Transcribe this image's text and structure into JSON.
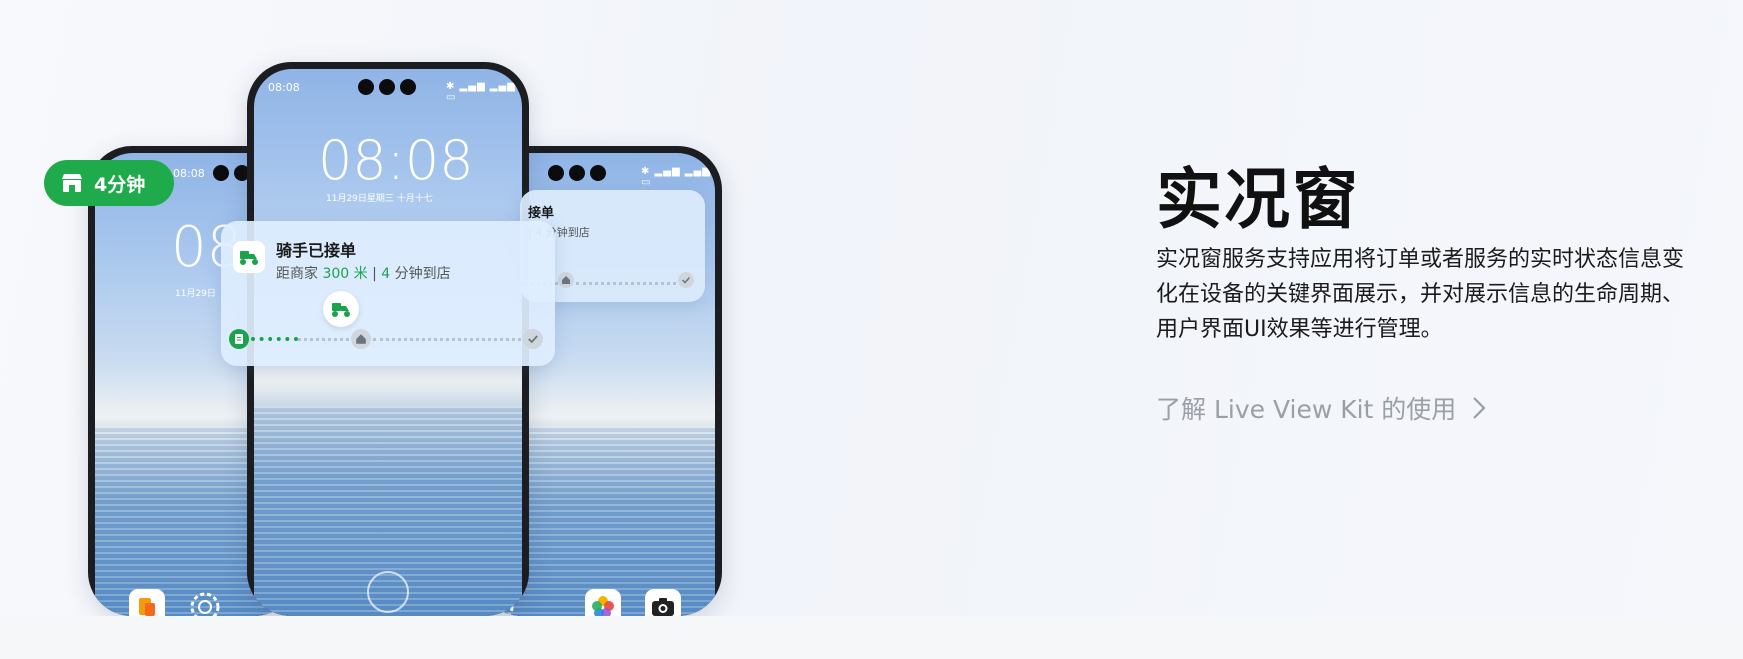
{
  "pill": {
    "label": "4分钟"
  },
  "phones": {
    "left": {
      "status_time": "08:08",
      "lock_time": "08",
      "lock_date": "11月29日"
    },
    "center": {
      "status_time": "08:08",
      "lock_time": "08:08",
      "lock_date": "11月29日星期三  十月十七"
    },
    "right": {
      "card_title": "接单",
      "card_sub_prefix": "| ",
      "card_sub_minutes": "4",
      "card_sub_suffix": " 分钟到店"
    }
  },
  "live_card": {
    "title": "骑手已接单",
    "sub_prefix": "距商家 ",
    "distance": "300 米",
    "sep": " | ",
    "minutes": "4",
    "sub_suffix": " 分钟到店",
    "progress": 0.38
  },
  "headline": "实况窗",
  "description": "实况窗服务支持应用将订单或者服务的实时状态信息变化在设备的关键界面展示，并对展示信息的生命周期、用户界面UI效果等进行管理。",
  "learn_link": "了解 Live View Kit 的使用",
  "colors": {
    "accent_green": "#1faa4c",
    "link_gray": "#9aa0a6"
  }
}
